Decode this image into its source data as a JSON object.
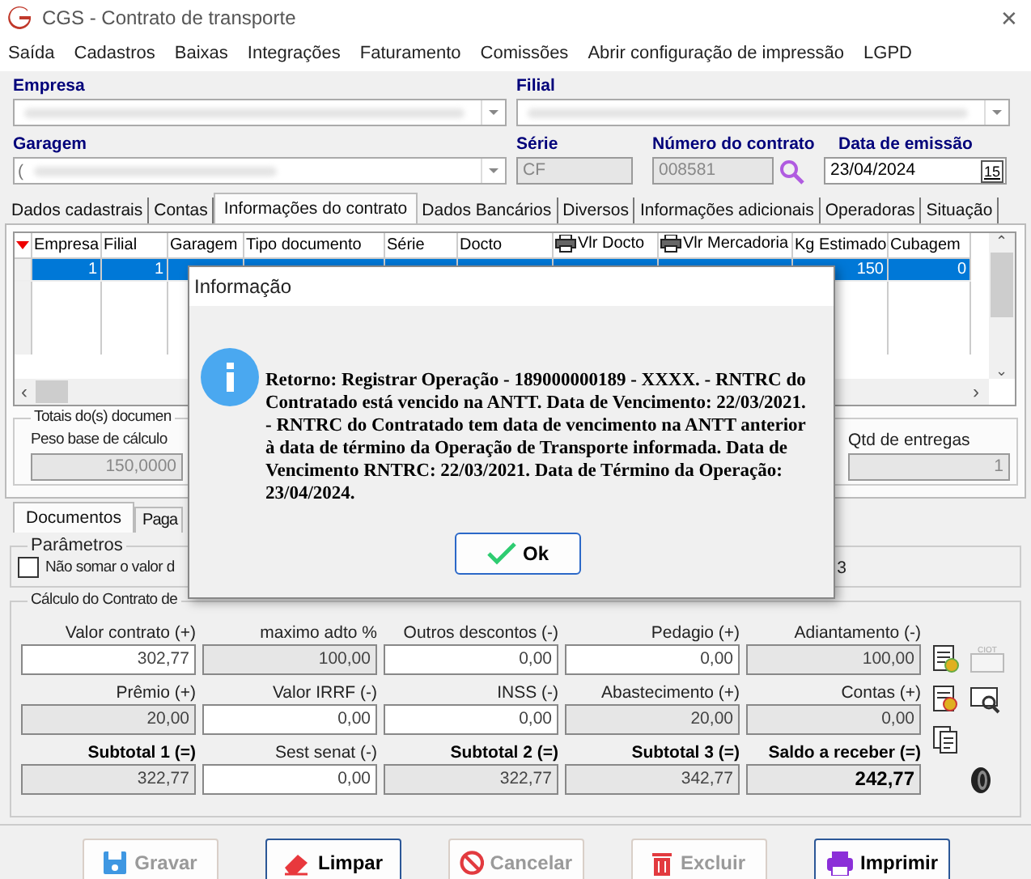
{
  "window": {
    "title": "CGS - Contrato de transporte",
    "close": "✕"
  },
  "menu": [
    "Saída",
    "Cadastros",
    "Baixas",
    "Integrações",
    "Faturamento",
    "Comissões",
    "Abrir configuração de impressão",
    "LGPD"
  ],
  "header": {
    "empresa_label": "Empresa",
    "filial_label": "Filial",
    "garagem_label": "Garagem",
    "garagem_value": "(",
    "serie_label": "Série",
    "serie_value": "CF",
    "numero_label": "Número do contrato",
    "numero_value": "008581",
    "data_label": "Data de emissão",
    "data_value": "23/04/2024",
    "calendar_button": "15"
  },
  "tabs": [
    {
      "label": "Dados cadastrais",
      "selected": false
    },
    {
      "label": "Contas",
      "selected": false
    },
    {
      "label": "Informações do contrato",
      "selected": true
    },
    {
      "label": "Dados Bancários",
      "selected": false
    },
    {
      "label": "Diversos",
      "selected": false
    },
    {
      "label": "Informações adicionais",
      "selected": false
    },
    {
      "label": "Operadoras",
      "selected": false
    },
    {
      "label": "Situação",
      "selected": false
    }
  ],
  "table": {
    "columns": [
      {
        "label": "Empresa",
        "printer": false
      },
      {
        "label": "Filial",
        "printer": false
      },
      {
        "label": "Garagem",
        "printer": false
      },
      {
        "label": "Tipo documento",
        "printer": false
      },
      {
        "label": "Série",
        "printer": false
      },
      {
        "label": "Docto",
        "printer": false
      },
      {
        "label": "Vlr Docto",
        "printer": true
      },
      {
        "label": "Vlr Mercadoria",
        "printer": true
      },
      {
        "label": "Kg Estimado",
        "printer": false
      },
      {
        "label": "Cubagem",
        "printer": false
      }
    ],
    "scroll_up": "⌃",
    "scroll_down": "⌄",
    "scroll_left": "‹",
    "scroll_right": "›",
    "rows": [
      {
        "selected": true,
        "cells": [
          "1",
          "1",
          null,
          null,
          null,
          null,
          null,
          null,
          "150",
          "0"
        ]
      }
    ]
  },
  "totais": {
    "title": "Totais do(s) documen",
    "peso_label": "Peso base de cálculo",
    "peso_value": "150,0000",
    "qtd_label": "Qtd de entregas",
    "qtd_value": "1"
  },
  "subtabs": [
    {
      "label": "Documentos",
      "selected": true
    },
    {
      "label": "Paga",
      "selected": false
    }
  ],
  "parametros": {
    "title": "Parâmetros",
    "checkbox_label": "Não somar o valor d",
    "checked": false,
    "right_text": "3"
  },
  "calculo": {
    "title": "Cálculo do Contrato de",
    "ciot_label": "CIOT",
    "rows": [
      [
        {
          "label": "Valor contrato (+)",
          "value": "302,77",
          "editable": true,
          "bold": false
        },
        {
          "label": "maximo adto %",
          "value": "100,00",
          "editable": false,
          "bold": false
        },
        {
          "label": "Outros descontos (-)",
          "value": "0,00",
          "editable": true,
          "bold": false
        },
        {
          "label": "Pedagio (+)",
          "value": "0,00",
          "editable": true,
          "bold": false
        },
        {
          "label": "Adiantamento (-)",
          "value": "100,00",
          "editable": false,
          "bold": false
        }
      ],
      [
        {
          "label": "Prêmio (+)",
          "value": "20,00",
          "editable": false,
          "bold": false
        },
        {
          "label": "Valor IRRF (-)",
          "value": "0,00",
          "editable": true,
          "bold": false
        },
        {
          "label": "INSS (-)",
          "value": "0,00",
          "editable": true,
          "bold": false
        },
        {
          "label": "Abastecimento (+)",
          "value": "20,00",
          "editable": false,
          "bold": false
        },
        {
          "label": "Contas (+)",
          "value": "0,00",
          "editable": false,
          "bold": false
        }
      ],
      [
        {
          "label": "Subtotal 1 (=)",
          "value": "322,77",
          "editable": false,
          "bold": true
        },
        {
          "label": "Sest senat (-)",
          "value": "0,00",
          "editable": true,
          "bold": false
        },
        {
          "label": "Subtotal 2 (=)",
          "value": "322,77",
          "editable": false,
          "bold": true
        },
        {
          "label": "Subtotal 3 (=)",
          "value": "342,77",
          "editable": false,
          "bold": true
        },
        {
          "label": "Saldo a receber (=)",
          "value": "242,77",
          "editable": false,
          "bold": true,
          "value_bold": true
        }
      ]
    ]
  },
  "buttons": [
    {
      "kind": "save",
      "label": "Gravar",
      "disabled": true
    },
    {
      "kind": "clear",
      "label": "Limpar",
      "disabled": false
    },
    {
      "kind": "cancel",
      "label": "Cancelar",
      "disabled": true
    },
    {
      "kind": "delete",
      "label": "Excluir",
      "disabled": true
    },
    {
      "kind": "print",
      "label": "Imprimir",
      "disabled": false
    }
  ],
  "dialog": {
    "title": "Informação",
    "message": "Retorno: Registrar Operação - 189000000189 - XXXX. - RNTRC do Contratado está vencido na ANTT. Data de Vencimento: 22/03/2021. - RNTRC do Contratado tem data de vencimento na ANTT anterior à data de término da Operação de Transporte informada. Data de Vencimento RNTRC: 22/03/2021. Data de Término da Operação: 23/04/2024.",
    "ok": "Ok"
  }
}
